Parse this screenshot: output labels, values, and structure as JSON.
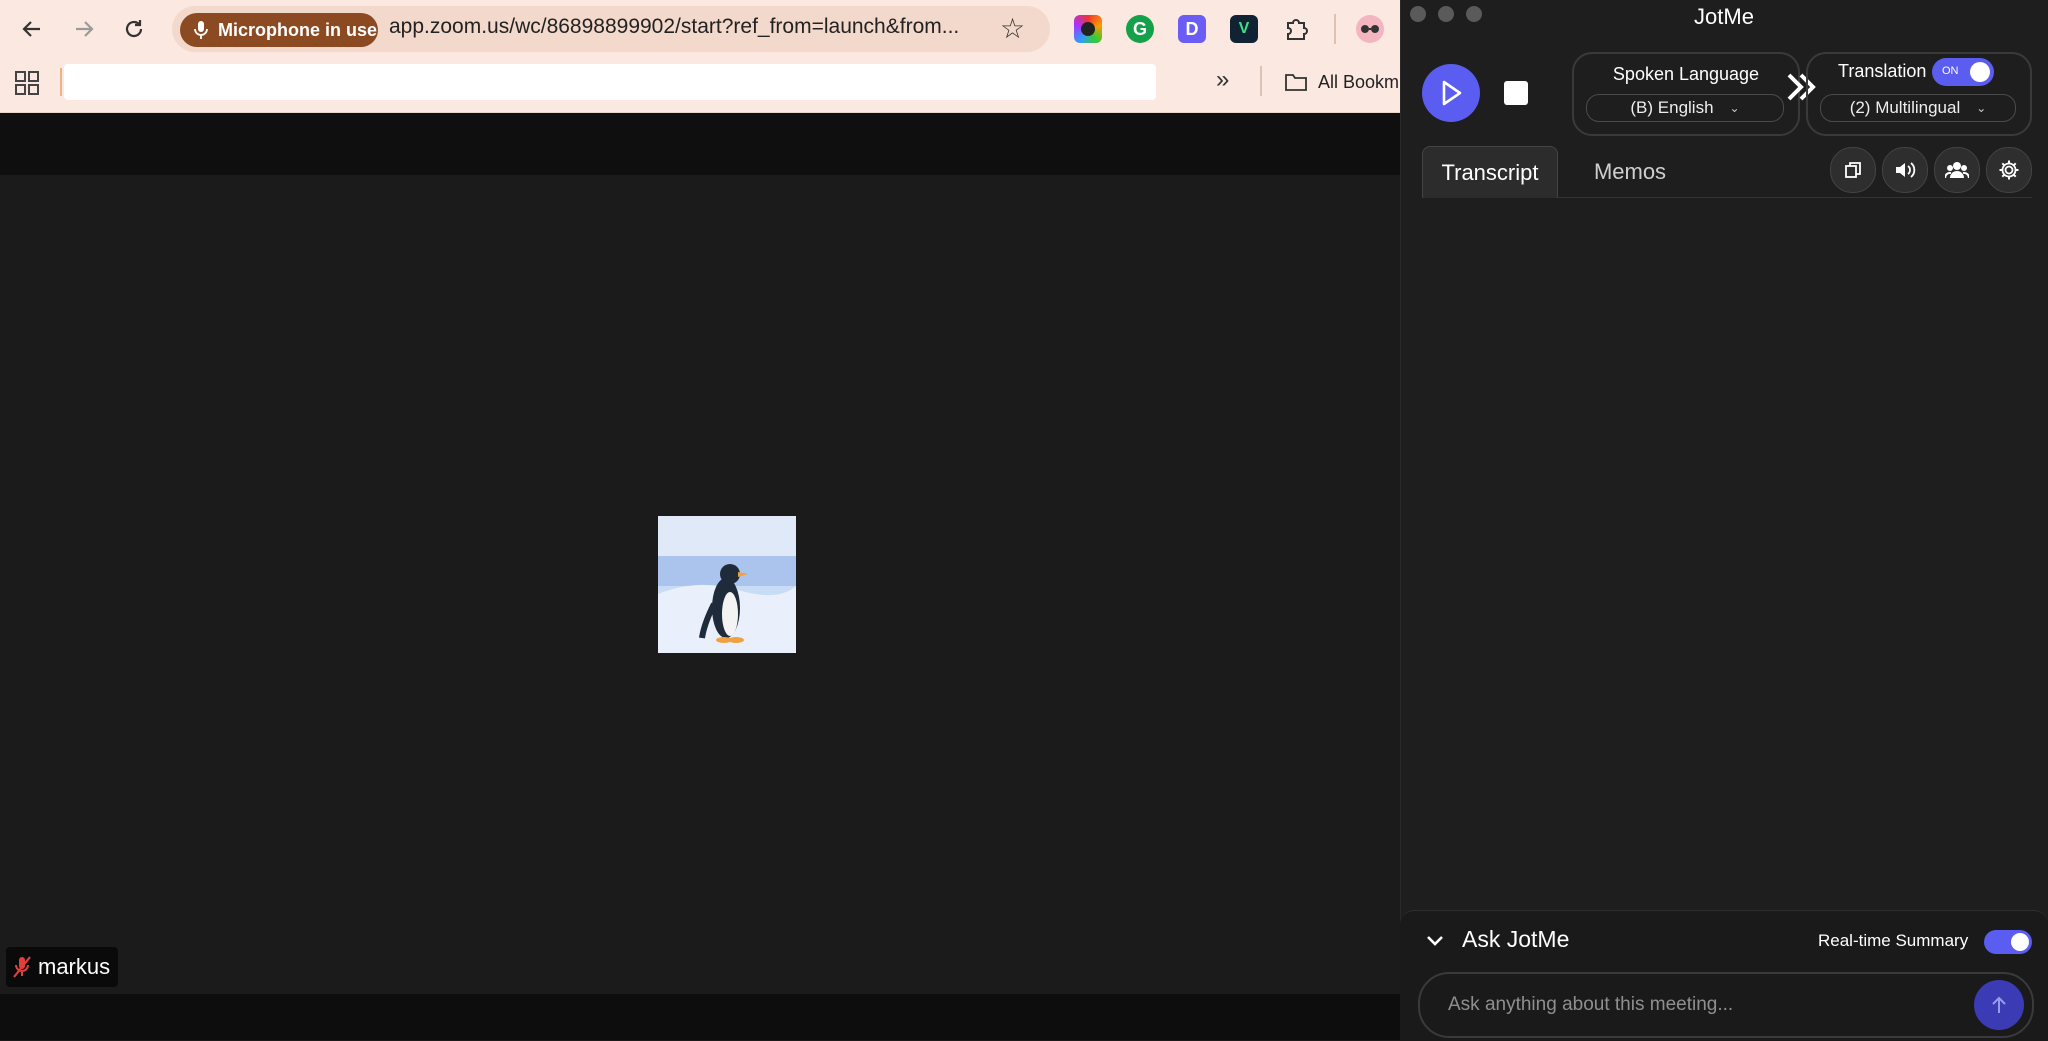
{
  "browser": {
    "mic_chip": "Microphone in use",
    "url": "app.zoom.us/wc/86898899902/start?ref_from=launch&from...",
    "bookmarks": {
      "all_label": "All Bookm"
    }
  },
  "zoom": {
    "participant_name": "markus"
  },
  "jotme": {
    "title": "JotMe",
    "spoken_language": {
      "label": "Spoken Language",
      "value": "(B) English"
    },
    "translation": {
      "label": "Translation",
      "toggle_text": "ON",
      "value": "(2) Multilingual"
    },
    "tabs": [
      {
        "label": "Transcript",
        "active": true
      },
      {
        "label": "Memos",
        "active": false
      }
    ],
    "ask": {
      "title": "Ask JotMe",
      "realtime_summary_label": "Real-time Summary",
      "placeholder": "Ask anything about this meeting..."
    }
  },
  "colors": {
    "accent": "#5b5cf0",
    "mic_chip": "#8b4a22",
    "browser_bar": "#fbe9e1"
  }
}
